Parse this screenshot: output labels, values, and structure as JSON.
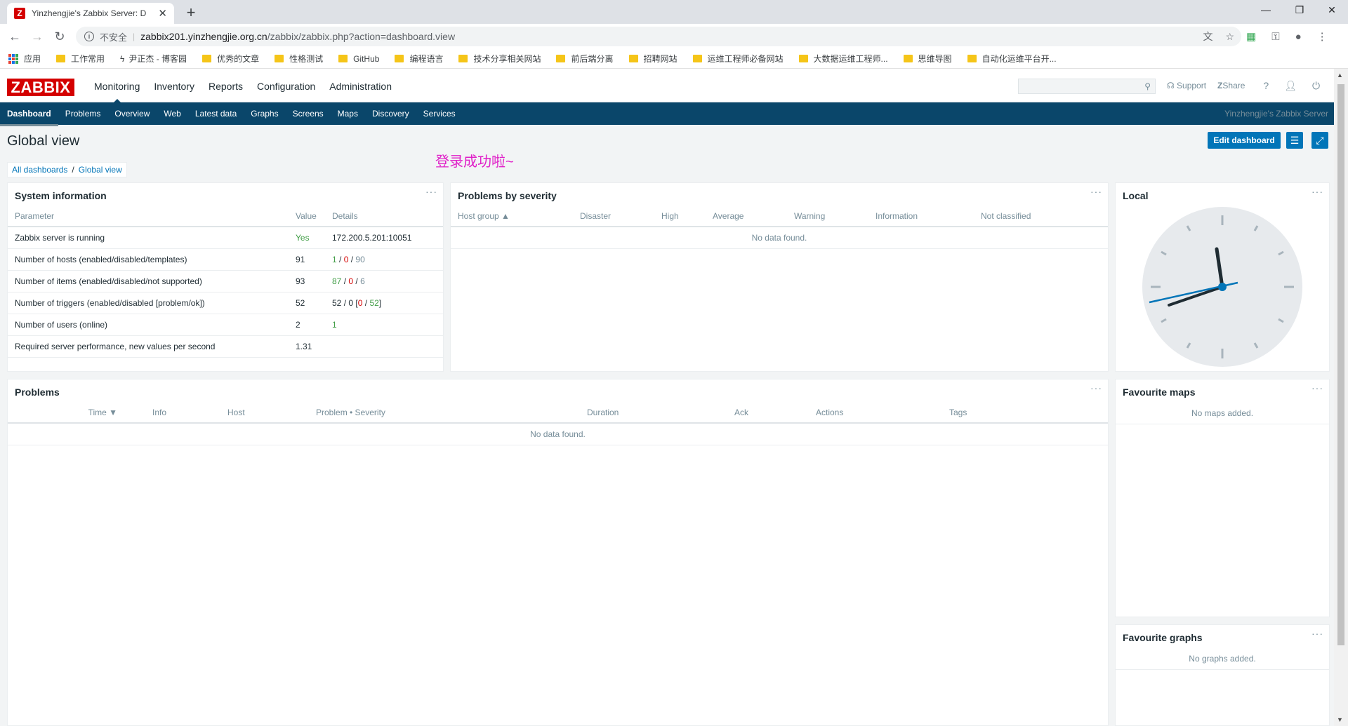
{
  "browser": {
    "tab_title": "Yinzhengjie's Zabbix Server: D",
    "favicon_letter": "Z",
    "insecure_label": "不安全",
    "url_host": "zabbix201.yinzhengjie.org.cn",
    "url_path": "/zabbix/zabbix.php?action=dashboard.view",
    "bookmarks": [
      "应用",
      "工作常用",
      "尹正杰 - 博客园",
      "优秀的文章",
      "性格测试",
      "GitHub",
      "编程语言",
      "技术分享相关网站",
      "前后端分离",
      "招聘网站",
      "运维工程师必备网站",
      "大数据运维工程师...",
      "思维导图",
      "自动化运维平台开..."
    ]
  },
  "header": {
    "logo": "ZABBIX",
    "menu": [
      "Monitoring",
      "Inventory",
      "Reports",
      "Configuration",
      "Administration"
    ],
    "support": "Support",
    "share": "Share",
    "help": "?"
  },
  "submenu": {
    "items": [
      "Dashboard",
      "Problems",
      "Overview",
      "Web",
      "Latest data",
      "Graphs",
      "Screens",
      "Maps",
      "Discovery",
      "Services"
    ],
    "server_name": "Yinzhengjie's Zabbix Server"
  },
  "page": {
    "title": "Global view",
    "edit_label": "Edit dashboard",
    "breadcrumb": [
      "All dashboards",
      "Global view"
    ],
    "note": "登录成功啦~"
  },
  "system_info": {
    "title": "System information",
    "menu": "···",
    "headers": [
      "Parameter",
      "Value",
      "Details"
    ],
    "rows": [
      {
        "param": "Zabbix server is running",
        "value": "Yes",
        "details": "172.200.5.201:10051"
      },
      {
        "param": "Number of hosts (enabled/disabled/templates)",
        "value": "91",
        "d1": "1",
        "d2": "0",
        "d3": "90"
      },
      {
        "param": "Number of items (enabled/disabled/not supported)",
        "value": "93",
        "d1": "87",
        "d2": "0",
        "d3": "6"
      },
      {
        "param": "Number of triggers (enabled/disabled [problem/ok])",
        "value": "52",
        "d1": "52",
        "d2": "0",
        "d3": "0",
        "d4": "52"
      },
      {
        "param": "Number of users (online)",
        "value": "2",
        "details": "1"
      },
      {
        "param": "Required server performance, new values per second",
        "value": "1.31",
        "details": ""
      }
    ]
  },
  "problems_by_severity": {
    "title": "Problems by severity",
    "menu": "···",
    "headers": [
      "Host group ▲",
      "Disaster",
      "High",
      "Average",
      "Warning",
      "Information",
      "Not classified"
    ],
    "empty": "No data found."
  },
  "local_clock": {
    "title": "Local",
    "menu": "···"
  },
  "problems": {
    "title": "Problems",
    "menu": "···",
    "headers": [
      "Time ▼",
      "Info",
      "Host",
      "Problem • Severity",
      "Duration",
      "Ack",
      "Actions",
      "Tags"
    ],
    "empty": "No data found."
  },
  "fav_maps": {
    "title": "Favourite maps",
    "menu": "···",
    "empty": "No maps added."
  },
  "fav_graphs": {
    "title": "Favourite graphs",
    "menu": "···",
    "empty": "No graphs added."
  }
}
